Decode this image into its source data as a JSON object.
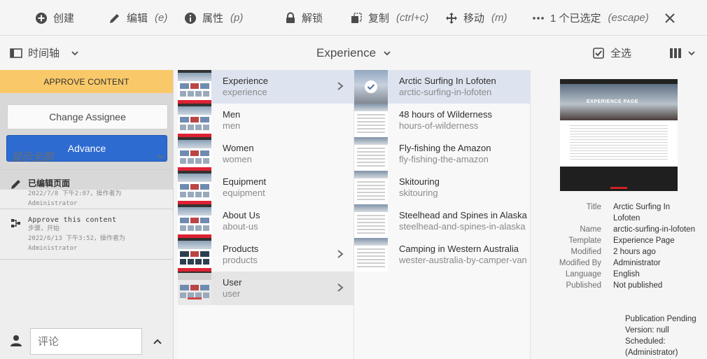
{
  "actionbar": {
    "create": "创建",
    "edit": "编辑",
    "edit_hint": "(e)",
    "properties": "属性",
    "properties_hint": "(p)",
    "unlock": "解锁",
    "copy": "复制",
    "copy_hint": "(ctrl+c)",
    "move": "移动",
    "move_hint": "(m)",
    "selected": "1 个已选定",
    "selected_hint": "(escape)"
  },
  "toolbar": {
    "rail_toggle": "时间轴",
    "breadcrumb": "Experience",
    "select_all": "全选"
  },
  "rail": {
    "workflow_status": "APPROVE CONTENT",
    "change_assignee": "Change Assignee",
    "advance": "Advance",
    "filter": "显示全部",
    "entries": [
      {
        "title": "已编辑页面",
        "line1": "2022/7/8 下午2:07，操作者为",
        "line2": "Administrator"
      },
      {
        "title": "Approve this content",
        "line1": "步骤，开始",
        "line2": "2022/6/13 下午3:52，操作者为",
        "line3": "Administrator"
      }
    ],
    "comment_placeholder": "评论"
  },
  "column1": [
    {
      "title": "Experience",
      "name": "experience",
      "has_children": true,
      "selected": true,
      "thumb": "web"
    },
    {
      "title": "Men",
      "name": "men",
      "has_children": false,
      "thumb": "web"
    },
    {
      "title": "Women",
      "name": "women",
      "has_children": false,
      "thumb": "web"
    },
    {
      "title": "Equipment",
      "name": "equipment",
      "has_children": false,
      "thumb": "web"
    },
    {
      "title": "About Us",
      "name": "about-us",
      "has_children": false,
      "thumb": "web"
    },
    {
      "title": "Products",
      "name": "products",
      "has_children": true,
      "thumb": "prod"
    },
    {
      "title": "User",
      "name": "user",
      "has_children": true,
      "thumb": "user"
    }
  ],
  "column2": [
    {
      "title": "Arctic Surfing In Lofoten",
      "name": "arctic-surfing-in-lofoten",
      "selected": true
    },
    {
      "title": "48 hours of Wilderness",
      "name": "hours-of-wilderness"
    },
    {
      "title": "Fly-fishing the Amazon",
      "name": "fly-fishing-the-amazon"
    },
    {
      "title": "Skitouring",
      "name": "skitouring"
    },
    {
      "title": "Steelhead and Spines in Alaska",
      "name": "steelhead-and-spines-in-alaska"
    },
    {
      "title": "Camping in Western Australia",
      "name": "wester-australia-by-camper-van"
    }
  ],
  "preview": {
    "hero_text": "EXPERIENCE PAGE",
    "meta": [
      {
        "label": "Title",
        "value": "Arctic Surfing In Lofoten"
      },
      {
        "label": "Name",
        "value": "arctic-surfing-in-lofoten"
      },
      {
        "label": "Template",
        "value": "Experience Page"
      },
      {
        "label": "Modified",
        "value": "2 hours ago"
      },
      {
        "label": "Modified By",
        "value": "Administrator"
      },
      {
        "label": "Language",
        "value": "English"
      },
      {
        "label": "Published",
        "value": "Not published"
      }
    ],
    "publication": [
      "Publication Pending",
      "Version: null",
      "Scheduled:",
      "(Administrator)"
    ]
  }
}
